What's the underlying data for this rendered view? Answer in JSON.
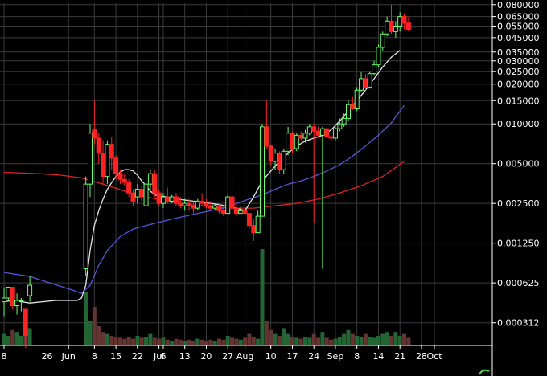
{
  "chart_data": {
    "type": "candlestick",
    "yscale": "log",
    "ylim": [
      0.00021,
      0.082
    ],
    "xlim": [
      -8,
      114
    ],
    "background": "#000000",
    "colors": {
      "up": "#66ff66",
      "down": "#ff2222",
      "ma_fast": "#e6e6e6",
      "ma_mid": "#5555dd",
      "ma_slow": "#dd2222",
      "volume_up": "#226633",
      "volume_down": "#663333",
      "grid": "#3a3a3a"
    },
    "y_ticks": [
      "0.080000",
      "0.065000",
      "0.055000",
      "0.045000",
      "0.035000",
      "0.030000",
      "0.025000",
      "0.020000",
      "0.015000",
      "0.010000",
      "0.005000",
      "0.002500",
      "0.001250",
      "0.000625",
      "0.000312"
    ],
    "y_tick_values": [
      0.08,
      0.065,
      0.055,
      0.045,
      0.035,
      0.03,
      0.025,
      0.02,
      0.015,
      0.01,
      0.005,
      0.0025,
      0.00125,
      0.000625,
      0.000312
    ],
    "x_ticks": [
      {
        "label": "8",
        "x": -8
      },
      {
        "label": "26",
        "x": 2
      },
      {
        "label": "Jun",
        "x": 7
      },
      {
        "label": "8",
        "x": 13
      },
      {
        "label": "15",
        "x": 18
      },
      {
        "label": "22",
        "x": 23
      },
      {
        "label": "Jul",
        "x": 28
      },
      {
        "label": "6",
        "x": 29
      },
      {
        "label": "13",
        "x": 34
      },
      {
        "label": "20",
        "x": 39
      },
      {
        "label": "27",
        "x": 44
      },
      {
        "label": "Aug",
        "x": 48
      },
      {
        "label": "10",
        "x": 54
      },
      {
        "label": "17",
        "x": 59
      },
      {
        "label": "24",
        "x": 64
      },
      {
        "label": "Sep",
        "x": 69
      },
      {
        "label": "8",
        "x": 74
      },
      {
        "label": "14",
        "x": 79
      },
      {
        "label": "21",
        "x": 84
      },
      {
        "label": "28",
        "x": 89
      },
      {
        "label": "Oct",
        "x": 92
      }
    ],
    "candles": [
      [
        0.00045,
        0.00058,
        0.00035,
        0.00048
      ],
      [
        0.00048,
        0.00058,
        0.00045,
        0.00058
      ],
      [
        0.00058,
        0.00058,
        0.0004,
        0.00042
      ],
      [
        0.00042,
        0.00052,
        0.00036,
        0.00046
      ],
      [
        0.00046,
        0.00048,
        0.00038,
        0.00046
      ],
      [
        0.0004,
        0.0004,
        0.0002,
        0.00025
      ],
      [
        0.0005,
        0.0007,
        0.00045,
        0.0006
      ],
      [
        0.0008,
        0.004,
        0.0007,
        0.0035
      ],
      [
        0.0035,
        0.01,
        0.0028,
        0.0085
      ],
      [
        0.009,
        0.015,
        0.007,
        0.0078
      ],
      [
        0.0078,
        0.0085,
        0.005,
        0.006
      ],
      [
        0.006,
        0.0075,
        0.0035,
        0.004
      ],
      [
        0.004,
        0.0075,
        0.0035,
        0.007
      ],
      [
        0.007,
        0.008,
        0.0045,
        0.0055
      ],
      [
        0.0055,
        0.0058,
        0.0038,
        0.0042
      ],
      [
        0.0042,
        0.0045,
        0.0035,
        0.0038
      ],
      [
        0.0038,
        0.0042,
        0.0034,
        0.0036
      ],
      [
        0.0036,
        0.0038,
        0.0028,
        0.003
      ],
      [
        0.003,
        0.0032,
        0.0024,
        0.0026
      ],
      [
        0.0028,
        0.0035,
        0.0025,
        0.0032
      ],
      [
        0.0032,
        0.0034,
        0.0026,
        0.0028
      ],
      [
        0.0024,
        0.0036,
        0.0022,
        0.0035
      ],
      [
        0.0035,
        0.0045,
        0.0032,
        0.0042
      ],
      [
        0.0042,
        0.0045,
        0.0028,
        0.003
      ],
      [
        0.003,
        0.0032,
        0.0024,
        0.0025
      ],
      [
        0.0025,
        0.003,
        0.0023,
        0.0028
      ],
      [
        0.0028,
        0.0033,
        0.0025,
        0.0026
      ],
      [
        0.0026,
        0.0029,
        0.0025,
        0.0028
      ],
      [
        0.0028,
        0.003,
        0.0024,
        0.0025
      ],
      [
        0.0025,
        0.0028,
        0.0023,
        0.0024
      ],
      [
        0.0024,
        0.0027,
        0.0022,
        0.0025
      ],
      [
        0.0025,
        0.0027,
        0.0022,
        0.0024
      ],
      [
        0.0024,
        0.0026,
        0.0021,
        0.0023
      ],
      [
        0.0023,
        0.0027,
        0.0022,
        0.0026
      ],
      [
        0.0026,
        0.003,
        0.0024,
        0.0025
      ],
      [
        0.0025,
        0.0027,
        0.0023,
        0.0024
      ],
      [
        0.0024,
        0.0026,
        0.0022,
        0.0023
      ],
      [
        0.0023,
        0.0025,
        0.0022,
        0.0024
      ],
      [
        0.0024,
        0.0025,
        0.0021,
        0.0022
      ],
      [
        0.0022,
        0.0024,
        0.002,
        0.0021
      ],
      [
        0.0021,
        0.0029,
        0.0021,
        0.0028
      ],
      [
        0.0028,
        0.0042,
        0.0021,
        0.0023
      ],
      [
        0.0023,
        0.0025,
        0.002,
        0.0021
      ],
      [
        0.0021,
        0.0024,
        0.0021,
        0.0022
      ],
      [
        0.0022,
        0.0024,
        0.002,
        0.0021
      ],
      [
        0.0021,
        0.0021,
        0.0016,
        0.0017
      ],
      [
        0.0017,
        0.0019,
        0.0013,
        0.0015
      ],
      [
        0.0015,
        0.0022,
        0.0015,
        0.002
      ],
      [
        0.002,
        0.01,
        0.002,
        0.0095
      ],
      [
        0.0095,
        0.015,
        0.0065,
        0.0068
      ],
      [
        0.0068,
        0.007,
        0.0048,
        0.0052
      ],
      [
        0.0052,
        0.0065,
        0.0045,
        0.006
      ],
      [
        0.006,
        0.0062,
        0.0042,
        0.0045
      ],
      [
        0.0045,
        0.0065,
        0.0042,
        0.0062
      ],
      [
        0.0062,
        0.0095,
        0.0058,
        0.0085
      ],
      [
        0.0085,
        0.0088,
        0.006,
        0.0065
      ],
      [
        0.0065,
        0.0085,
        0.0062,
        0.0082
      ],
      [
        0.0082,
        0.0088,
        0.0075,
        0.0078
      ],
      [
        0.0078,
        0.009,
        0.0072,
        0.0085
      ],
      [
        0.0085,
        0.01,
        0.0082,
        0.0095
      ],
      [
        0.0095,
        0.01,
        0.0018,
        0.0088
      ],
      [
        0.0088,
        0.0095,
        0.0078,
        0.0082
      ],
      [
        0.0082,
        0.0095,
        0.0008,
        0.0092
      ],
      [
        0.0092,
        0.0095,
        0.0078,
        0.008
      ],
      [
        0.008,
        0.0085,
        0.0075,
        0.0078
      ],
      [
        0.0078,
        0.0095,
        0.0075,
        0.0092
      ],
      [
        0.0092,
        0.011,
        0.0088,
        0.01
      ],
      [
        0.01,
        0.012,
        0.0095,
        0.011
      ],
      [
        0.011,
        0.015,
        0.0105,
        0.014
      ],
      [
        0.014,
        0.016,
        0.0128,
        0.013
      ],
      [
        0.013,
        0.019,
        0.0125,
        0.018
      ],
      [
        0.018,
        0.025,
        0.0175,
        0.022
      ],
      [
        0.022,
        0.024,
        0.018,
        0.019
      ],
      [
        0.019,
        0.025,
        0.0185,
        0.024
      ],
      [
        0.024,
        0.03,
        0.0235,
        0.028
      ],
      [
        0.028,
        0.04,
        0.027,
        0.038
      ],
      [
        0.038,
        0.05,
        0.036,
        0.048
      ],
      [
        0.048,
        0.065,
        0.046,
        0.06
      ],
      [
        0.06,
        0.08,
        0.048,
        0.05
      ],
      [
        0.05,
        0.06,
        0.045,
        0.055
      ],
      [
        0.055,
        0.07,
        0.05,
        0.065
      ],
      [
        0.065,
        0.068,
        0.052,
        0.058
      ],
      [
        0.058,
        0.065,
        0.05,
        0.052
      ]
    ],
    "candle_x": [
      -8,
      -7,
      -6,
      -5,
      -4,
      -3,
      -2,
      11,
      12,
      13,
      14,
      15,
      16,
      17,
      18,
      19,
      20,
      21,
      22,
      23,
      24,
      25,
      26,
      27,
      28,
      29,
      30,
      31,
      32,
      33,
      34,
      35,
      36,
      37,
      38,
      39,
      40,
      41,
      42,
      43,
      44,
      45,
      46,
      47,
      48,
      49,
      50,
      51,
      52,
      53,
      54,
      55,
      56,
      57,
      58,
      59,
      60,
      61,
      62,
      63,
      64,
      65,
      66,
      67,
      68,
      69,
      70,
      71,
      72,
      73,
      74,
      75,
      76,
      77,
      78,
      79,
      80,
      81,
      82,
      83,
      84,
      85,
      86
    ],
    "ma_fast": [
      [
        -8,
        0.00045
      ],
      [
        -6,
        0.00046
      ],
      [
        -4,
        0.00045
      ],
      [
        -2,
        0.00044
      ],
      [
        1,
        0.00045
      ],
      [
        4,
        0.00046
      ],
      [
        7,
        0.00046
      ],
      [
        9,
        0.00046
      ],
      [
        10,
        0.00048
      ],
      [
        11,
        0.0006
      ],
      [
        12,
        0.0011
      ],
      [
        13,
        0.0017
      ],
      [
        14,
        0.0022
      ],
      [
        15,
        0.0027
      ],
      [
        16,
        0.0032
      ],
      [
        17,
        0.0036
      ],
      [
        18,
        0.004
      ],
      [
        19,
        0.0043
      ],
      [
        20,
        0.0045
      ],
      [
        21,
        0.0045
      ],
      [
        22,
        0.0044
      ],
      [
        23,
        0.0041
      ],
      [
        24,
        0.0037
      ],
      [
        25,
        0.0034
      ],
      [
        26,
        0.0031
      ],
      [
        27,
        0.0029
      ],
      [
        28,
        0.00285
      ],
      [
        30,
        0.0028
      ],
      [
        32,
        0.0027
      ],
      [
        34,
        0.00265
      ],
      [
        36,
        0.0026
      ],
      [
        38,
        0.00255
      ],
      [
        40,
        0.0025
      ],
      [
        42,
        0.00245
      ],
      [
        44,
        0.00237
      ],
      [
        46,
        0.0023
      ],
      [
        48,
        0.0022
      ],
      [
        50,
        0.0028
      ],
      [
        52,
        0.0037
      ],
      [
        54,
        0.0044
      ],
      [
        56,
        0.0052
      ],
      [
        58,
        0.006
      ],
      [
        60,
        0.0068
      ],
      [
        62,
        0.0074
      ],
      [
        64,
        0.0078
      ],
      [
        66,
        0.0082
      ],
      [
        68,
        0.009
      ],
      [
        70,
        0.0105
      ],
      [
        72,
        0.0125
      ],
      [
        74,
        0.015
      ],
      [
        76,
        0.018
      ],
      [
        78,
        0.022
      ],
      [
        80,
        0.027
      ],
      [
        82,
        0.032
      ],
      [
        84,
        0.036
      ]
    ],
    "ma_mid": [
      [
        -8,
        0.00075
      ],
      [
        -2,
        0.0007
      ],
      [
        3,
        0.00062
      ],
      [
        8,
        0.00055
      ],
      [
        10,
        0.00052
      ],
      [
        12,
        0.0006
      ],
      [
        14,
        0.00085
      ],
      [
        16,
        0.0011
      ],
      [
        19,
        0.0014
      ],
      [
        22,
        0.0016
      ],
      [
        25,
        0.0017
      ],
      [
        28,
        0.0018
      ],
      [
        31,
        0.0019
      ],
      [
        34,
        0.002
      ],
      [
        37,
        0.0021
      ],
      [
        40,
        0.0022
      ],
      [
        43,
        0.0023
      ],
      [
        46,
        0.0025
      ],
      [
        49,
        0.0027
      ],
      [
        52,
        0.0029
      ],
      [
        55,
        0.0032
      ],
      [
        58,
        0.0035
      ],
      [
        61,
        0.0037
      ],
      [
        64,
        0.004
      ],
      [
        67,
        0.0044
      ],
      [
        70,
        0.0049
      ],
      [
        73,
        0.0057
      ],
      [
        76,
        0.0068
      ],
      [
        79,
        0.0082
      ],
      [
        82,
        0.0102
      ],
      [
        85,
        0.0138
      ]
    ],
    "ma_slow": [
      [
        -8,
        0.0043
      ],
      [
        0,
        0.0042
      ],
      [
        5,
        0.0041
      ],
      [
        10,
        0.0039
      ],
      [
        15,
        0.0035
      ],
      [
        20,
        0.0031
      ],
      [
        25,
        0.0028
      ],
      [
        30,
        0.0026
      ],
      [
        35,
        0.00245
      ],
      [
        40,
        0.00235
      ],
      [
        45,
        0.0023
      ],
      [
        50,
        0.0023
      ],
      [
        55,
        0.0024
      ],
      [
        60,
        0.0025
      ],
      [
        65,
        0.0027
      ],
      [
        70,
        0.003
      ],
      [
        75,
        0.0034
      ],
      [
        80,
        0.004
      ],
      [
        85,
        0.0052
      ]
    ],
    "volume": [
      0.12,
      0.1,
      0.16,
      0.14,
      0.1,
      0.22,
      0.18,
      0.55,
      0.25,
      0.4,
      0.2,
      0.14,
      0.12,
      0.1,
      0.09,
      0.08,
      0.07,
      0.09,
      0.07,
      0.1,
      0.08,
      0.09,
      0.12,
      0.08,
      0.07,
      0.08,
      0.06,
      0.05,
      0.07,
      0.06,
      0.05,
      0.06,
      0.05,
      0.07,
      0.06,
      0.05,
      0.06,
      0.05,
      0.07,
      0.06,
      0.1,
      0.08,
      0.07,
      0.06,
      0.08,
      0.12,
      0.09,
      0.07,
      1.0,
      0.25,
      0.16,
      0.12,
      0.1,
      0.18,
      0.12,
      0.09,
      0.08,
      0.07,
      0.09,
      0.08,
      0.12,
      0.08,
      0.14,
      0.08,
      0.06,
      0.07,
      0.09,
      0.12,
      0.16,
      0.12,
      0.1,
      0.09,
      0.12,
      0.09,
      0.08,
      0.1,
      0.12,
      0.14,
      0.1,
      0.14,
      0.1,
      0.12,
      0.08
    ]
  }
}
